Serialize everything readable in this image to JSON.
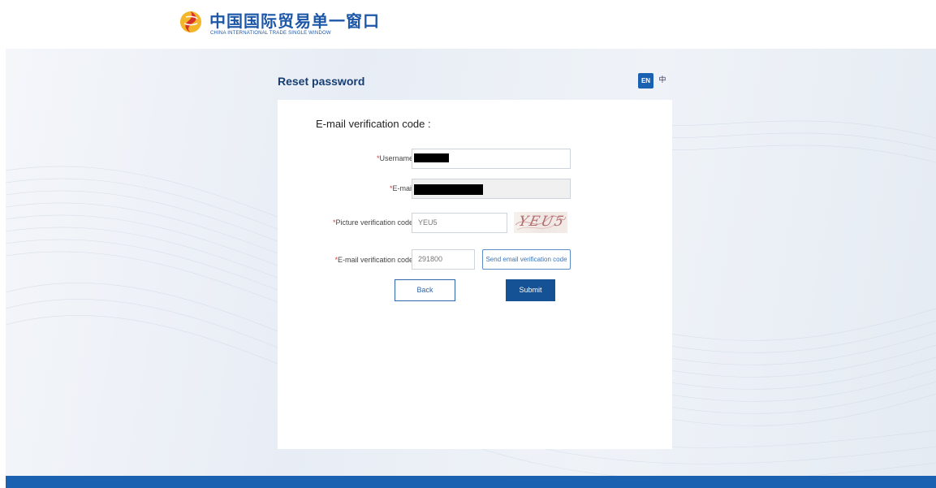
{
  "header": {
    "logo_cn": "中国国际贸易单一窗口",
    "logo_en": "CHINA INTERNATIONAL TRADE SINGLE WINDOW"
  },
  "title_bar": {
    "title": "Reset password",
    "lang_en": "EN",
    "lang_cn": "中"
  },
  "form": {
    "section_title": "E-mail verification code :",
    "required_mark": "*",
    "username": {
      "label": "Username :",
      "value": ""
    },
    "email": {
      "label": "E-mail :",
      "value": ""
    },
    "picture_code": {
      "label": "Picture verification code :",
      "value": "YEU5",
      "captcha_text": "YEU5"
    },
    "email_code": {
      "label": "E-mail verification code :",
      "value": "291800"
    },
    "send_button": "Send email verification code",
    "back_button": "Back",
    "submit_button": "Submit"
  },
  "colors": {
    "brand_blue": "#1b61b1",
    "title_navy": "#163e73",
    "submit_blue": "#155195",
    "required_red": "#e23a3a"
  },
  "icons": {
    "logo": "trade-window-emblem-icon"
  }
}
